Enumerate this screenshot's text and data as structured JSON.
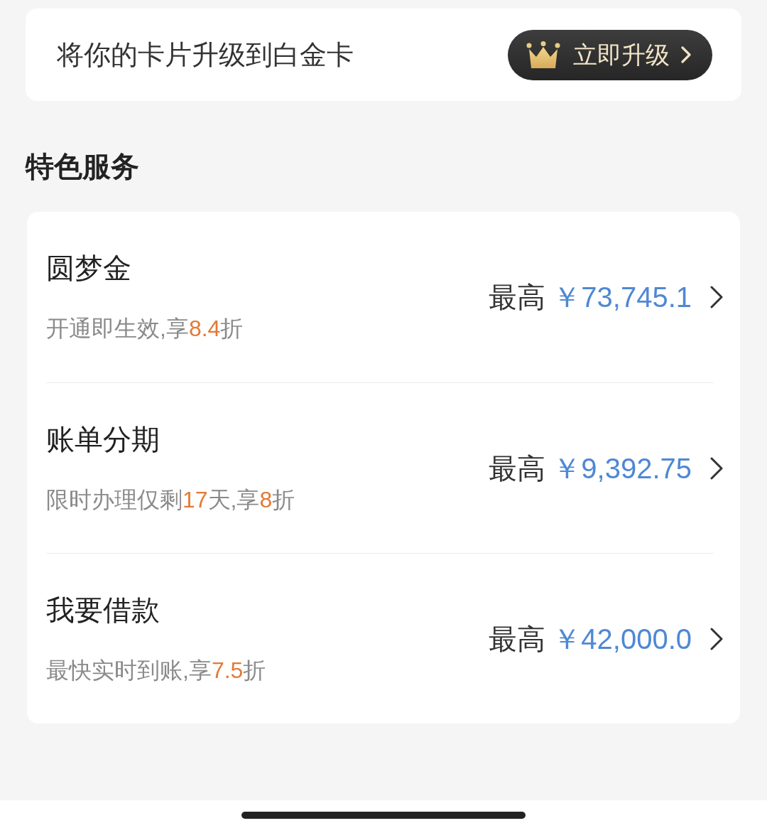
{
  "upgrade_banner": {
    "text": "将你的卡片升级到白金卡",
    "button": "立即升级"
  },
  "section_title": "特色服务",
  "services": [
    {
      "title": "圆梦金",
      "subtitle": [
        {
          "text": "开通即生效,享",
          "highlight": false
        },
        {
          "text": "8.4",
          "highlight": true
        },
        {
          "text": "折",
          "highlight": false
        }
      ],
      "amount_label": "最高",
      "amount": "￥73,745.1"
    },
    {
      "title": "账单分期",
      "subtitle": [
        {
          "text": "限时办理仅剩",
          "highlight": false
        },
        {
          "text": "17",
          "highlight": true
        },
        {
          "text": "天,享",
          "highlight": false
        },
        {
          "text": "8",
          "highlight": true
        },
        {
          "text": "折",
          "highlight": false
        }
      ],
      "amount_label": "最高",
      "amount": "￥9,392.75"
    },
    {
      "title": "我要借款",
      "subtitle": [
        {
          "text": "最快实时到账,享",
          "highlight": false
        },
        {
          "text": "7.5",
          "highlight": true
        },
        {
          "text": "折",
          "highlight": false
        }
      ],
      "amount_label": "最高",
      "amount": "￥42,000.0"
    }
  ]
}
